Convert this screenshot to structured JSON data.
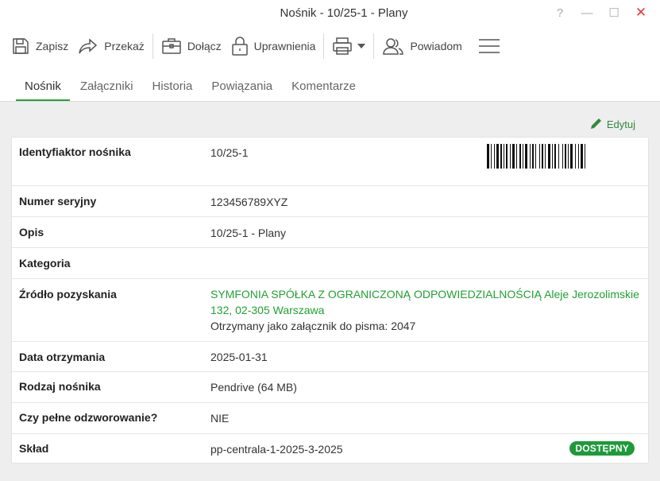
{
  "window": {
    "title": "Nośnik - 10/25-1 - Plany",
    "help": "?",
    "minimize": "—",
    "maximize": "☐",
    "close": "✕"
  },
  "toolbar": {
    "save": "Zapisz",
    "forward": "Przekaż",
    "attach": "Dołącz",
    "permissions": "Uprawnienia",
    "notify": "Powiadom"
  },
  "tabs": [
    "Nośnik",
    "Załączniki",
    "Historia",
    "Powiązania",
    "Komentarze"
  ],
  "edit_label": "Edytuj",
  "fields": {
    "id_label": "Identyfiaktor nośnika",
    "id_value": "10/25-1",
    "serial_label": "Numer seryjny",
    "serial_value": "123456789XYZ",
    "desc_label": "Opis",
    "desc_value": "10/25-1 - Plany",
    "category_label": "Kategoria",
    "category_value": "",
    "source_label": "Źródło pozyskania",
    "source_value_line1": "SYMFONIA SPÓŁKA Z OGRANICZONĄ ODPOWIEDZIALNOŚCIĄ Aleje Jerozolimskie",
    "source_value_line2": "132, 02-305 Warszawa",
    "source_note": "Otrzymany jako załącznik do pisma: 2047",
    "date_label": "Data otrzymania",
    "date_value": "2025-01-31",
    "type_label": "Rodzaj nośnika",
    "type_value": "Pendrive (64 MB)",
    "full_label": "Czy pełne odzworowanie?",
    "full_value": "NIE",
    "storage_label": "Skład",
    "storage_value": "pp-centrala-1-2025-3-2025",
    "storage_badge": "DOSTĘPNY"
  },
  "colors": {
    "accent": "#2e9e3c",
    "link_green": "#23a034",
    "badge_green": "#1e9a3a",
    "close_red": "#e53935"
  }
}
